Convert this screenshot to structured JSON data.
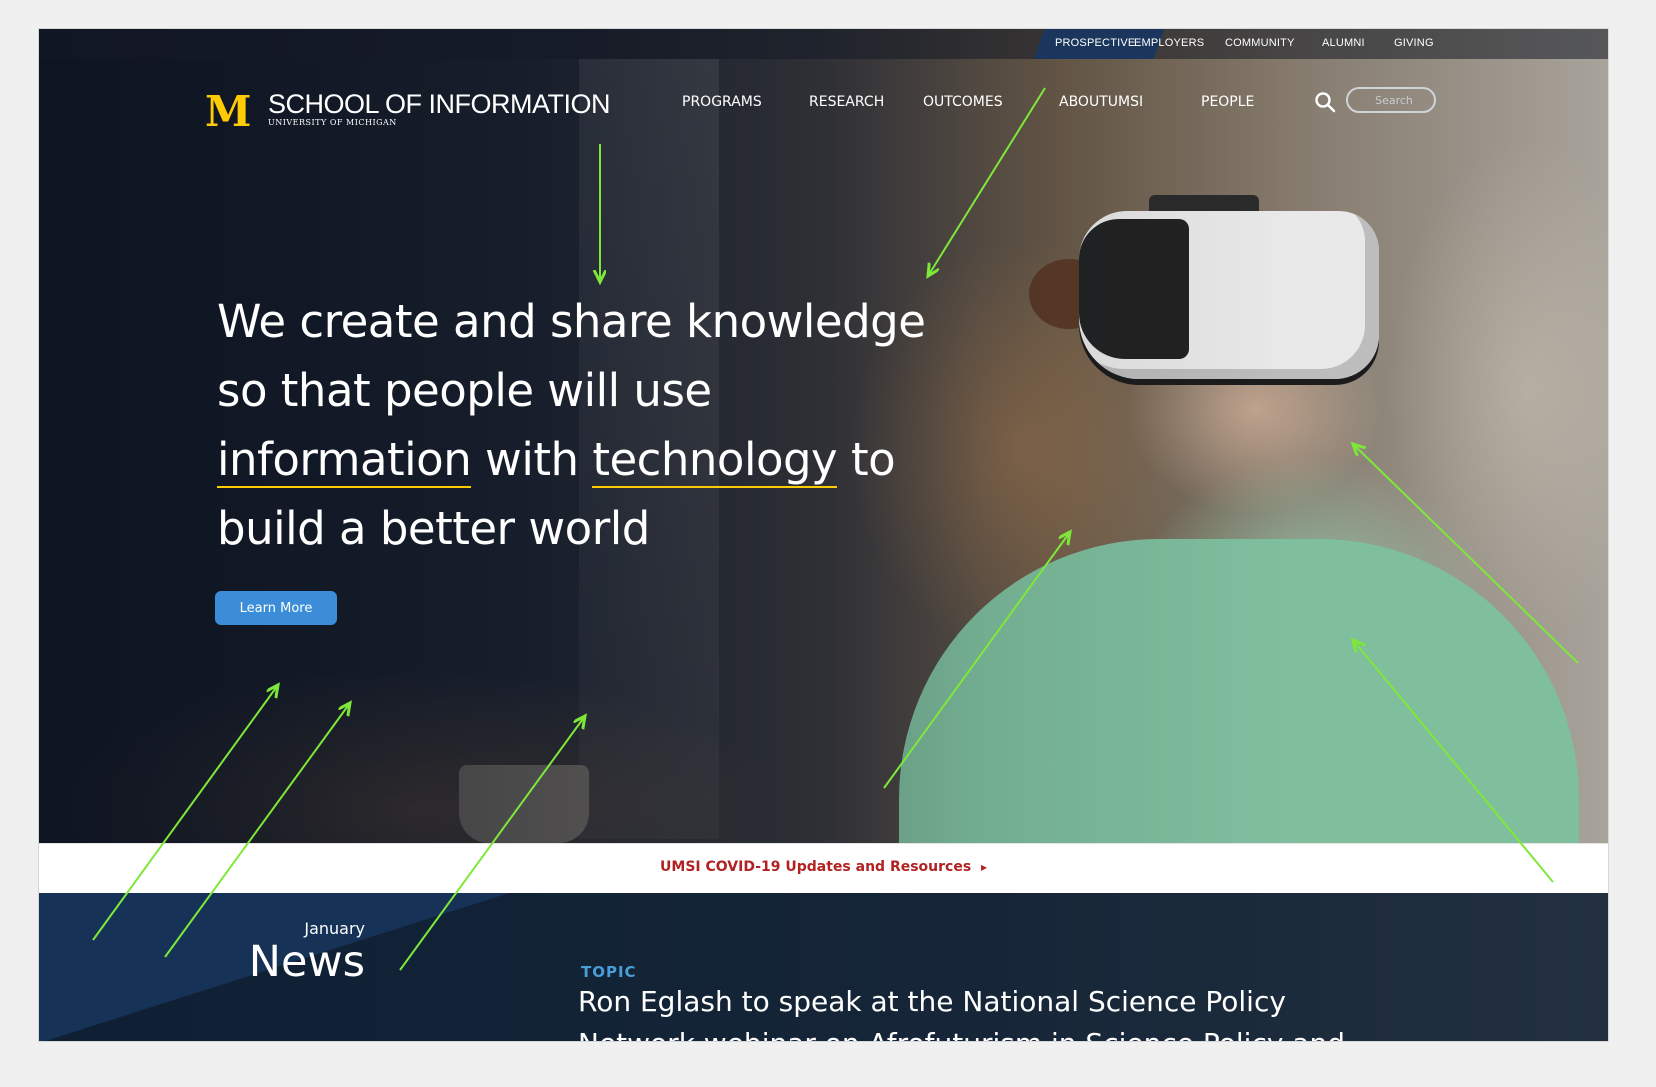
{
  "utility_nav": {
    "items": [
      "PROSPECTIVE",
      "EMPLOYERS",
      "COMMUNITY",
      "ALUMNI",
      "GIVING"
    ],
    "active": "PROSPECTIVE"
  },
  "brand": {
    "logo_letter": "M",
    "title": "SCHOOL OF INFORMATION",
    "subtitle": "UNIVERSITY OF MICHIGAN",
    "logo_color": "#ffcb05"
  },
  "main_nav": {
    "items": [
      "PROGRAMS",
      "RESEARCH",
      "OUTCOMES",
      "ABOUTUMSI",
      "PEOPLE"
    ]
  },
  "search": {
    "placeholder": "Search",
    "icon": "search-icon"
  },
  "hero": {
    "headline_part1": "We create and share knowledge so that people will use ",
    "highlight1": "information",
    "headline_part2": " with ",
    "highlight2": "technology",
    "headline_part3": " to build a better world",
    "button_label": "Learn More",
    "button_color": "#3a8dd6",
    "underline_color": "#ffcb05"
  },
  "alert_bar": {
    "link_text": "UMSI COVID-19 Updates and Resources",
    "arrow": "▸",
    "color": "#b22222"
  },
  "news": {
    "month": "January",
    "title": "News",
    "topic_label": "TOPIC",
    "headline": "Ron Eglash to speak at the National Science Policy",
    "headline_cut": "Network webinar on Afrofuturism in Science Policy and"
  },
  "colors": {
    "annotation_arrow": "#7ee83a",
    "navy": "#1b365d"
  }
}
